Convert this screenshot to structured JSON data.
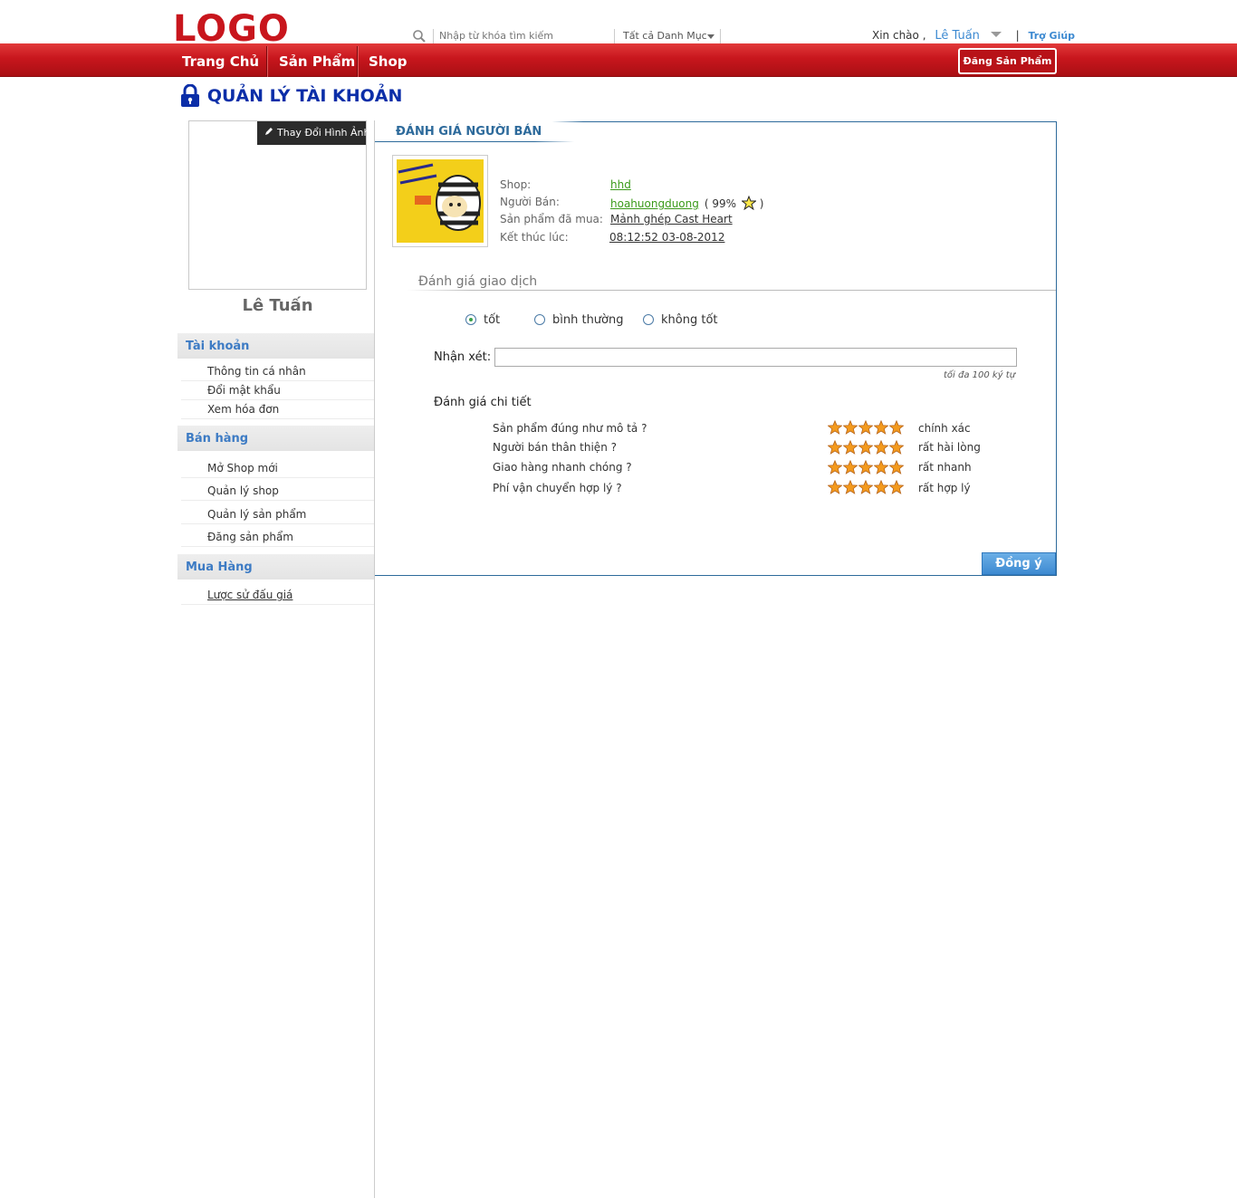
{
  "header": {
    "logo": "LOGO",
    "search_placeholder": "Nhập từ khóa tìm kiếm",
    "category": "Tất cả Danh Mục",
    "greeting": "Xin chào ,",
    "username": "Lê Tuấn",
    "separator": "|",
    "help": "Trợ Giúp"
  },
  "nav": {
    "items": [
      "Trang Chủ",
      "Sản Phẩm",
      "Shop"
    ],
    "post_button": "Đăng Sản Phẩm"
  },
  "page_title": "QUẢN LÝ TÀI KHOẢN",
  "sidebar": {
    "change_image": "Thay Đổi Hình Ảnh",
    "profile_name": "Lê Tuấn",
    "sections": [
      {
        "title": "Tài khoản",
        "items": [
          "Thông tin cá nhân",
          "Đổi mật khẩu",
          "Xem hóa đơn"
        ]
      },
      {
        "title": "Bán hàng",
        "items": [
          "Mở Shop mới",
          "Quản lý shop",
          "Quản lý sản phẩm",
          "Đăng sản phẩm"
        ]
      },
      {
        "title": "Mua Hàng",
        "items": [
          "Lược sử đấu giá"
        ]
      }
    ]
  },
  "review": {
    "title": "ĐÁNH GIÁ NGƯỜI BÁN",
    "shop_label": "Shop:",
    "shop_value": "hhd",
    "seller_label": "Người Bán:",
    "seller_value": "hoahuongduong",
    "seller_rating_open": "( 99%",
    "seller_rating_close": ")",
    "product_label": "Sản phẩm đã mua:",
    "product_value": "Mảnh ghép Cast Heart",
    "end_label": "Kết thúc lúc:",
    "end_value": "08:12:52 03-08-2012",
    "transaction_heading": "Đánh giá giao dịch",
    "options": [
      "tốt",
      "bình thường",
      "không tốt"
    ],
    "selected_option": "tốt",
    "comment_label": "Nhận xét:",
    "comment_value": "",
    "comment_hint": "tối đa 100 ký tự",
    "detail_heading": "Đánh giá chi tiết",
    "criteria": [
      {
        "question": "Sản phẩm đúng như mô tả ?",
        "stars": 5,
        "result": "chính xác"
      },
      {
        "question": "Người bán thân thiện ?",
        "stars": 5,
        "result": "rất hài lòng"
      },
      {
        "question": "Giao hàng nhanh chóng ?",
        "stars": 5,
        "result": "rất nhanh"
      },
      {
        "question": "Phí vận chuyển hợp lý ?",
        "stars": 5,
        "result": "rất hợp lý"
      }
    ],
    "submit": "Đồng ý"
  },
  "colors": {
    "brand_red": "#c8161d",
    "title_blue": "#0b2ea8",
    "panel_blue": "#2d6a9b",
    "link_blue": "#3d8ad1",
    "link_green": "#3a9a1a",
    "star_orange": "#f39a1e"
  }
}
